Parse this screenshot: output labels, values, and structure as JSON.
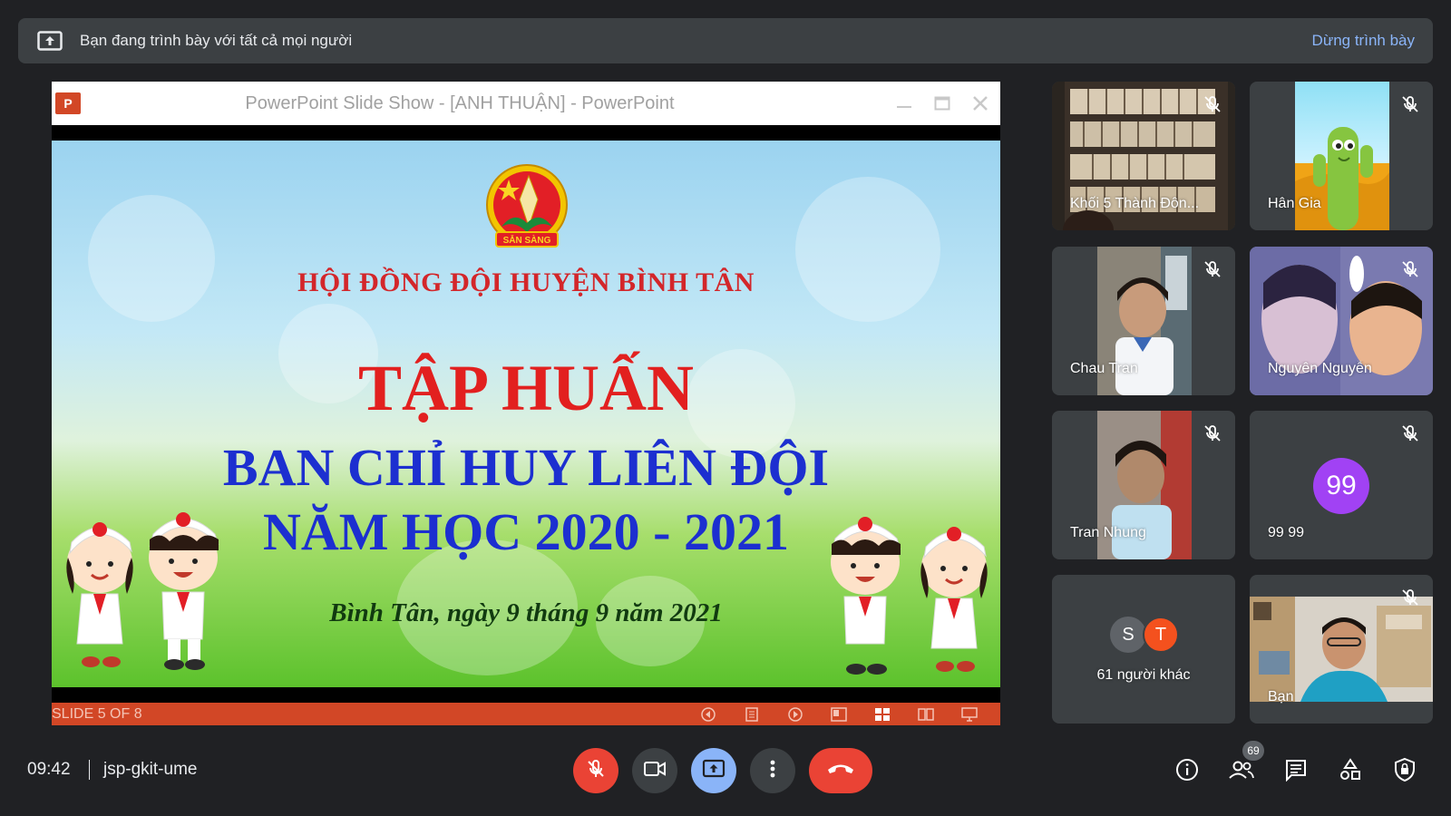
{
  "banner": {
    "text": "Bạn đang trình bày với tất cả mọi người",
    "stop_label": "Dừng trình bày"
  },
  "powerpoint": {
    "logo": "P",
    "window_title": "PowerPoint Slide Show - [ANH THUẬN] - PowerPoint",
    "slide_counter": "SLIDE 5 OF 8"
  },
  "slide": {
    "emblem_text": "SẴN SÀNG",
    "line1": "HỘI ĐỒNG ĐỘI HUYỆN BÌNH TÂN",
    "line2": "TẬP HUẤN",
    "line3": "BAN CHỈ HUY LIÊN ĐỘI",
    "line4": "NĂM HỌC 2020 - 2021",
    "line5": "Bình Tân, ngày 9 tháng 9 năm 2021"
  },
  "participants": [
    {
      "name": "Khối 5 Thành Đôn...",
      "muted": true
    },
    {
      "name": "Hân Gia",
      "muted": true
    },
    {
      "name": "Chau Tran",
      "muted": true
    },
    {
      "name": "Nguyên Nguyễn",
      "muted": true
    },
    {
      "name": "Tran Nhung",
      "muted": true
    },
    {
      "name": "99 99",
      "muted": true,
      "avatar": "99",
      "avatar_color": "#a142f4"
    },
    {
      "name": "61 người khác",
      "avatars": [
        {
          "letter": "S",
          "color": "#5f6368"
        },
        {
          "letter": "T",
          "color": "#f4511e"
        }
      ]
    },
    {
      "name": "Bạn",
      "muted": true
    }
  ],
  "meeting": {
    "time": "09:42",
    "code": "jsp-gkit-ume",
    "participant_count": "69"
  },
  "colors": {
    "background": "#202124",
    "surface": "#3c4043",
    "accent": "#8ab4f8",
    "danger": "#ea4335",
    "present_active": "#8ab4f8"
  }
}
